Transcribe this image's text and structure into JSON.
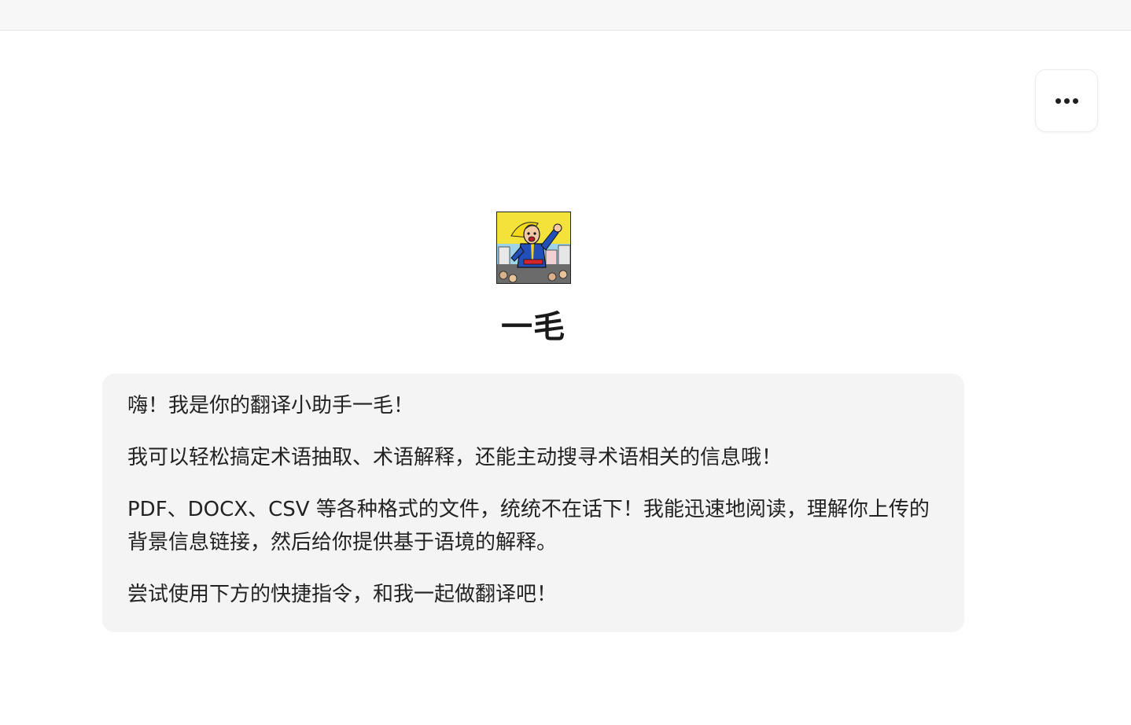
{
  "header": {},
  "menu": {
    "more_icon": "more-horizontal-icon"
  },
  "bot": {
    "name": "一毛",
    "avatar_icon": "comic-hero-avatar"
  },
  "welcome": {
    "paragraphs": [
      "嗨！我是你的翻译小助手一毛！",
      "我可以轻松搞定术语抽取、术语解释，还能主动搜寻术语相关的信息哦！",
      "PDF、DOCX、CSV 等各种格式的文件，统统不在话下！我能迅速地阅读，理解你上传的背景信息链接，然后给你提供基于语境的解释。",
      "尝试使用下方的快捷指令，和我一起做翻译吧！"
    ]
  },
  "colors": {
    "topbar_bg": "#f7f7f8",
    "card_bg": "#f4f4f5",
    "text": "#222222"
  }
}
